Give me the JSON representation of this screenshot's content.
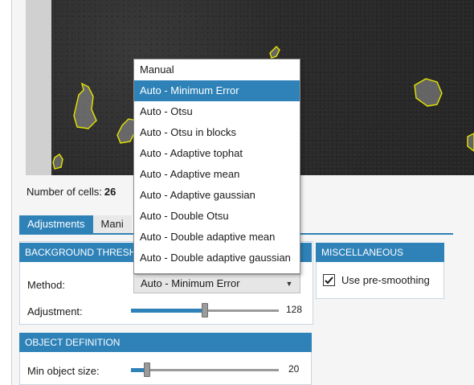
{
  "cells": {
    "label": "Number of cells:",
    "count": "26"
  },
  "tabs": [
    {
      "label": "Adjustments",
      "active": true
    },
    {
      "label": "Mani",
      "active": false
    }
  ],
  "background_threshold": {
    "title": "BACKGROUND THRESHOLD",
    "method_label": "Method:",
    "method_value": "Auto - Minimum Error",
    "adjustment_label": "Adjustment:",
    "adjustment_value": "128",
    "adjustment_fraction": 0.5
  },
  "object_definition": {
    "title": "OBJECT DEFINITION",
    "min_size_label": "Min object size:",
    "min_size_value": "20",
    "min_size_fraction": 0.09
  },
  "miscellaneous": {
    "title": "MISCELLANEOUS",
    "pre_smoothing_label": "Use pre-smoothing",
    "pre_smoothing_checked": true
  },
  "method_dropdown": {
    "options": [
      "Manual",
      "Auto - Minimum Error",
      "Auto - Otsu",
      "Auto - Otsu in blocks",
      "Auto - Adaptive tophat",
      "Auto - Adaptive mean",
      "Auto - Adaptive gaussian",
      "Auto - Double Otsu",
      "Auto - Double adaptive mean",
      "Auto - Double adaptive gaussian"
    ],
    "selected_index": 1
  },
  "colors": {
    "accent": "#2e82b8",
    "outline": "#e6e600"
  },
  "icons": {
    "dropdown_arrow": "chevron-down-icon",
    "check": "checkmark-icon"
  }
}
